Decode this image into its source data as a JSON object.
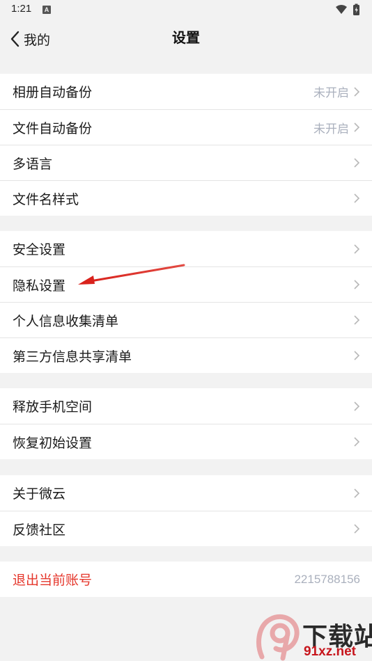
{
  "status_bar": {
    "time": "1:21",
    "notification_badge": "A"
  },
  "header": {
    "back_label": "我的",
    "title": "设置"
  },
  "groups": [
    {
      "items": [
        {
          "label": "相册自动备份",
          "value": "未开启"
        },
        {
          "label": "文件自动备份",
          "value": "未开启"
        },
        {
          "label": "多语言"
        },
        {
          "label": "文件名样式"
        }
      ]
    },
    {
      "items": [
        {
          "label": "安全设置"
        },
        {
          "label": "隐私设置"
        },
        {
          "label": "个人信息收集清单"
        },
        {
          "label": "第三方信息共享清单"
        }
      ]
    },
    {
      "items": [
        {
          "label": "释放手机空间"
        },
        {
          "label": "恢复初始设置"
        }
      ]
    },
    {
      "items": [
        {
          "label": "关于微云"
        },
        {
          "label": "反馈社区"
        }
      ]
    }
  ],
  "logout": {
    "label": "退出当前账号",
    "account": "2215788156"
  },
  "watermark": {
    "title": "下载站",
    "url": "91xz.net",
    "logo_text": "9"
  },
  "colors": {
    "background": "#f2f2f2",
    "card": "#ffffff",
    "danger": "#e5362b",
    "secondary_text": "#aab0bd",
    "annotation_arrow": "#d9221c"
  }
}
